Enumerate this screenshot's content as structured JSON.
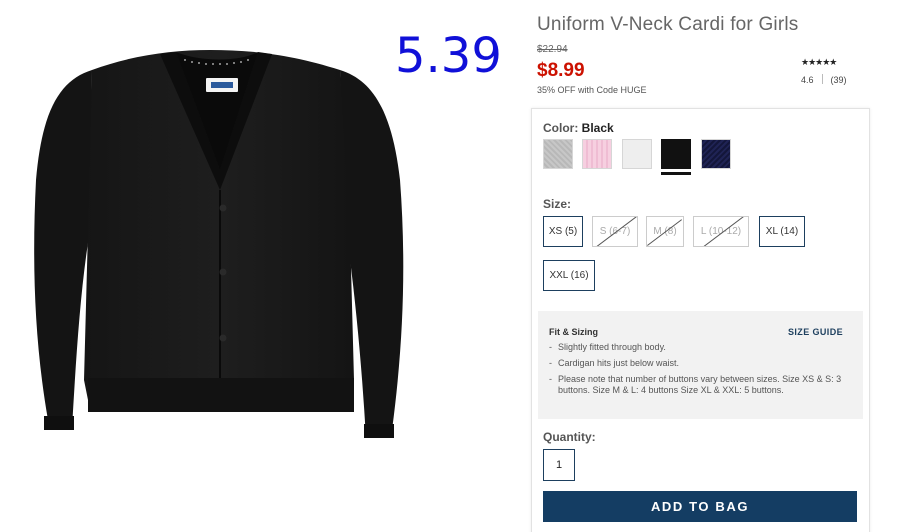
{
  "overlay": {
    "number": "5.39"
  },
  "product": {
    "title": "Uniform V-Neck Cardi for Girls",
    "image_name": "black-cardigan-photo",
    "tag_text": "old navy"
  },
  "price": {
    "original": "$22.94",
    "sale": "$8.99",
    "promo": "35% OFF with Code HUGE"
  },
  "rating": {
    "stars": "★★★★★",
    "value": "4.6",
    "count": "(39)",
    "stars_value": 4.6,
    "stars_max": 5
  },
  "color": {
    "label": "Color:",
    "selected": "Black",
    "swatches": [
      {
        "name": "heather-gray",
        "color": "#c0c0c0"
      },
      {
        "name": "pink",
        "color": "#f3c6da"
      },
      {
        "name": "white",
        "color": "#eeeeee"
      },
      {
        "name": "black",
        "color": "#111111",
        "selected": true
      },
      {
        "name": "navy",
        "color": "#1a1d4a"
      }
    ]
  },
  "size": {
    "label": "Size:",
    "options": [
      {
        "label": "XS (5)",
        "available": true
      },
      {
        "label": "S (6-7)",
        "available": false
      },
      {
        "label": "M (8)",
        "available": false
      },
      {
        "label": "L (10-12)",
        "available": false
      },
      {
        "label": "XL (14)",
        "available": true
      },
      {
        "label": "XXL (16)",
        "available": true
      }
    ]
  },
  "fit": {
    "title": "Fit & Sizing",
    "guide_label": "SIZE GUIDE",
    "items": [
      "Slightly fitted through body.",
      "Cardigan hits just below waist.",
      "Please note that number of buttons vary between sizes. Size XS & S: 3 buttons. Size M & L: 4 buttons Size XL & XXL: 5 buttons."
    ]
  },
  "quantity": {
    "label": "Quantity:",
    "value": "1"
  },
  "cta": {
    "add_to_bag": "ADD TO BAG"
  },
  "colors": {
    "brand_navy": "#143d63",
    "sale_red": "#cc1100",
    "overlay_blue": "#1010d8"
  }
}
